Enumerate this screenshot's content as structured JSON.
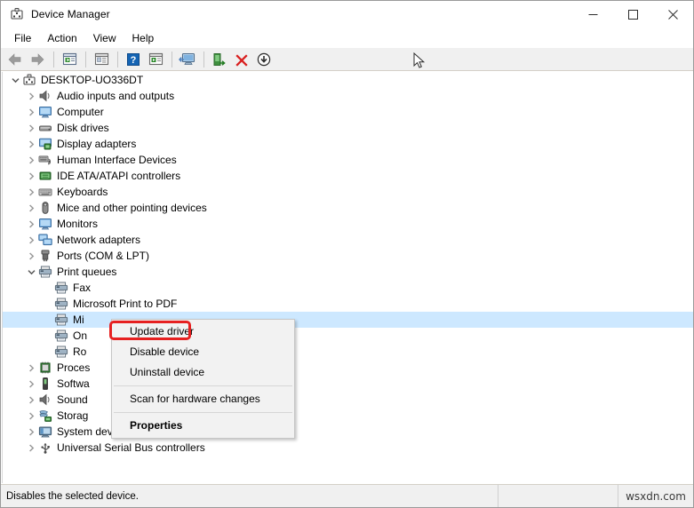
{
  "window": {
    "title": "Device Manager",
    "icon": "device-manager-icon",
    "controls": [
      {
        "name": "minimize-button",
        "glyph": "–"
      },
      {
        "name": "maximize-button",
        "glyph": "□"
      },
      {
        "name": "close-button",
        "glyph": "✕"
      }
    ]
  },
  "menubar": {
    "items": [
      "File",
      "Action",
      "View",
      "Help"
    ]
  },
  "toolbar": {
    "buttons": [
      {
        "name": "back-button",
        "icon": "back-arrow-icon"
      },
      {
        "name": "forward-button",
        "icon": "forward-arrow-icon"
      },
      {
        "name": "separator-1",
        "icon": "separator"
      },
      {
        "name": "up-one-level-button",
        "icon": "window-list-icon"
      },
      {
        "name": "separator-2",
        "icon": "separator"
      },
      {
        "name": "properties-button",
        "icon": "properties-window-icon"
      },
      {
        "name": "separator-3",
        "icon": "separator"
      },
      {
        "name": "help-button",
        "icon": "question-mark-icon"
      },
      {
        "name": "show-hidden-button",
        "icon": "window-play-icon"
      },
      {
        "name": "separator-4",
        "icon": "separator"
      },
      {
        "name": "scan-hardware-button",
        "icon": "monitor-scan-icon"
      },
      {
        "name": "separator-5",
        "icon": "separator"
      },
      {
        "name": "update-driver-button",
        "icon": "green-update-icon"
      },
      {
        "name": "uninstall-device-button",
        "icon": "red-x-icon"
      },
      {
        "name": "disable-device-button",
        "icon": "down-arrow-circle-icon"
      }
    ]
  },
  "tree": {
    "root": {
      "label": "DESKTOP-UO336DT",
      "icon": "computer-root-icon",
      "expanded": true
    },
    "nodes": [
      {
        "label": "Audio inputs and outputs",
        "icon": "speaker-icon",
        "indent": 1,
        "expanded": false,
        "selected": false
      },
      {
        "label": "Computer",
        "icon": "monitor-icon",
        "indent": 1,
        "expanded": false,
        "selected": false
      },
      {
        "label": "Disk drives",
        "icon": "disk-drive-icon",
        "indent": 1,
        "expanded": false,
        "selected": false
      },
      {
        "label": "Display adapters",
        "icon": "display-adapter-icon",
        "indent": 1,
        "expanded": false,
        "selected": false
      },
      {
        "label": "Human Interface Devices",
        "icon": "hid-icon",
        "indent": 1,
        "expanded": false,
        "selected": false
      },
      {
        "label": "IDE ATA/ATAPI controllers",
        "icon": "ide-controller-icon",
        "indent": 1,
        "expanded": false,
        "selected": false
      },
      {
        "label": "Keyboards",
        "icon": "keyboard-icon",
        "indent": 1,
        "expanded": false,
        "selected": false
      },
      {
        "label": "Mice and other pointing devices",
        "icon": "mouse-icon",
        "indent": 1,
        "expanded": false,
        "selected": false
      },
      {
        "label": "Monitors",
        "icon": "monitor-icon",
        "indent": 1,
        "expanded": false,
        "selected": false
      },
      {
        "label": "Network adapters",
        "icon": "network-adapter-icon",
        "indent": 1,
        "expanded": false,
        "selected": false
      },
      {
        "label": "Ports (COM & LPT)",
        "icon": "port-icon",
        "indent": 1,
        "expanded": false,
        "selected": false
      },
      {
        "label": "Print queues",
        "icon": "printer-icon",
        "indent": 1,
        "expanded": true,
        "selected": false
      },
      {
        "label": "Fax",
        "icon": "printer-icon",
        "indent": 2,
        "leaf": true,
        "selected": false
      },
      {
        "label": "Microsoft Print to PDF",
        "icon": "printer-icon",
        "indent": 2,
        "leaf": true,
        "selected": false
      },
      {
        "label": "Mi",
        "icon": "printer-icon",
        "indent": 2,
        "leaf": true,
        "selected": true
      },
      {
        "label": "On",
        "icon": "printer-icon",
        "indent": 2,
        "leaf": true,
        "selected": false
      },
      {
        "label": "Ro",
        "icon": "printer-icon",
        "indent": 2,
        "leaf": true,
        "selected": false
      },
      {
        "label": "Proces",
        "icon": "processor-icon",
        "indent": 1,
        "expanded": false,
        "selected": false
      },
      {
        "label": "Softwa",
        "icon": "software-device-icon",
        "indent": 1,
        "expanded": false,
        "selected": false
      },
      {
        "label": "Sound",
        "icon": "speaker-icon",
        "indent": 1,
        "expanded": false,
        "selected": false
      },
      {
        "label": "Storag",
        "icon": "storage-controller-icon",
        "indent": 1,
        "expanded": false,
        "selected": false
      },
      {
        "label": "System devices",
        "icon": "system-device-icon",
        "indent": 1,
        "expanded": false,
        "selected": false
      },
      {
        "label": "Universal Serial Bus controllers",
        "icon": "usb-icon",
        "indent": 1,
        "expanded": false,
        "selected": false
      }
    ]
  },
  "context_menu": {
    "items": [
      {
        "label": "Update driver",
        "bold": false,
        "highlighted": true
      },
      {
        "label": "Disable device",
        "bold": false,
        "highlighted": false
      },
      {
        "label": "Uninstall device",
        "bold": false,
        "highlighted": false
      },
      {
        "separator": true
      },
      {
        "label": "Scan for hardware changes",
        "bold": false,
        "highlighted": false
      },
      {
        "separator": true
      },
      {
        "label": "Properties",
        "bold": true,
        "highlighted": false
      }
    ]
  },
  "statusbar": {
    "message": "Disables the selected device.",
    "middle": "",
    "watermark": "wsxdn.com"
  },
  "colors": {
    "selection": "#cde8ff",
    "annotation": "#e62020",
    "toolbar_bg": "#f0f0f0",
    "menu_bg": "#f2f2f2"
  }
}
